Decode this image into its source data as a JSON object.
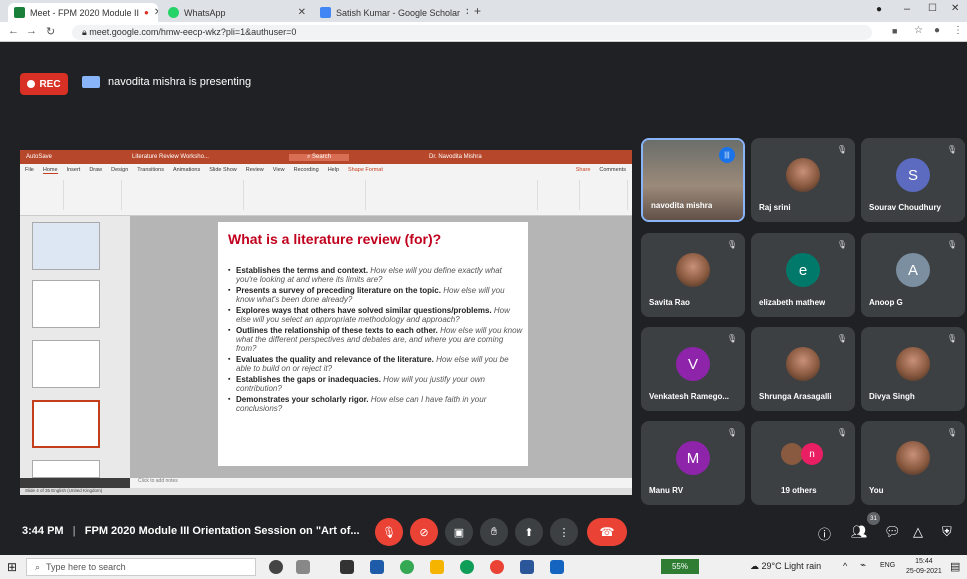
{
  "browser": {
    "tabs": [
      {
        "label": "Meet - FPM 2020 Module II",
        "color": "#188038"
      },
      {
        "label": "WhatsApp",
        "color": "#25d366"
      },
      {
        "label": "Satish Kumar - Google Scholar",
        "color": "#4285f4"
      }
    ],
    "url": "meet.google.com/hmw-eecp-wkz?pli=1&authuser=0"
  },
  "meet": {
    "rec_label": "REC",
    "presenting_text": "navodita mishra is presenting",
    "time": "3:44 PM",
    "meeting_title": "FPM 2020 Module III Orientation Session on \"Art of...",
    "people_count": "31",
    "participants": [
      {
        "name": "navodita mishra",
        "kind": "video"
      },
      {
        "name": "Raj srini",
        "kind": "photo"
      },
      {
        "name": "Sourav Choudhury",
        "kind": "letter",
        "letter": "S",
        "color": "#5c6bc0"
      },
      {
        "name": "Savita Rao",
        "kind": "photo"
      },
      {
        "name": "elizabeth mathew",
        "kind": "letter",
        "letter": "e",
        "color": "#00796b"
      },
      {
        "name": "Anoop G",
        "kind": "letter",
        "letter": "A",
        "color": "#7b8fa1"
      },
      {
        "name": "Venkatesh Ramego...",
        "kind": "letter",
        "letter": "V",
        "color": "#8e24aa"
      },
      {
        "name": "Shrunga Arasagalli",
        "kind": "photo"
      },
      {
        "name": "Divya Singh",
        "kind": "photo"
      },
      {
        "name": "Manu RV",
        "kind": "letter",
        "letter": "M",
        "color": "#8e24aa"
      },
      {
        "name": "19 others",
        "kind": "group",
        "letter": "n",
        "color": "#e91e63"
      },
      {
        "name": "You",
        "kind": "photo"
      }
    ]
  },
  "ppt": {
    "autosave": "AutoSave",
    "file": "Literature Review Worksho...",
    "search": "Search",
    "user": "Dr. Navodita Mishra",
    "menu": [
      "File",
      "Home",
      "Insert",
      "Draw",
      "Design",
      "Transitions",
      "Animations",
      "Slide Show",
      "Review",
      "View",
      "Recording",
      "Help",
      "Shape Format"
    ],
    "share": "Share",
    "comments": "Comments",
    "notes_placeholder": "Click to add notes",
    "status": "Slide 4 of 35   English (United Kingdom)",
    "slide": {
      "title": "What is a literature review (for)?",
      "bullets": [
        {
          "bold": "Establishes the terms and context.",
          "italic": "How else will you define exactly what you're looking at and where its limits are?"
        },
        {
          "bold": "Presents a survey of preceding literature on the topic.",
          "italic": "How else will you know what's been done already?"
        },
        {
          "bold": "Explores ways that others have solved similar questions/problems.",
          "italic": "How else will you select an appropriate methodology and approach?"
        },
        {
          "bold": "Outlines the relationship of these texts to each other.",
          "italic": "How else will you know what the different perspectives and debates are, and where you are coming from?"
        },
        {
          "bold": "Evaluates the quality and relevance of the literature.",
          "italic": "How else will you be able to build on or reject it?"
        },
        {
          "bold": "Establishes the gaps or inadequacies.",
          "italic": "How will you justify your own contribution?"
        },
        {
          "bold": "Demonstrates your scholarly rigor.",
          "italic": "How else can I have faith in your conclusions?"
        }
      ]
    }
  },
  "taskbar": {
    "search_placeholder": "Type here to search",
    "battery": "55%",
    "weather": "29°C  Light rain",
    "lang": "ENG",
    "time": "15:44",
    "date": "25-09-2021"
  }
}
